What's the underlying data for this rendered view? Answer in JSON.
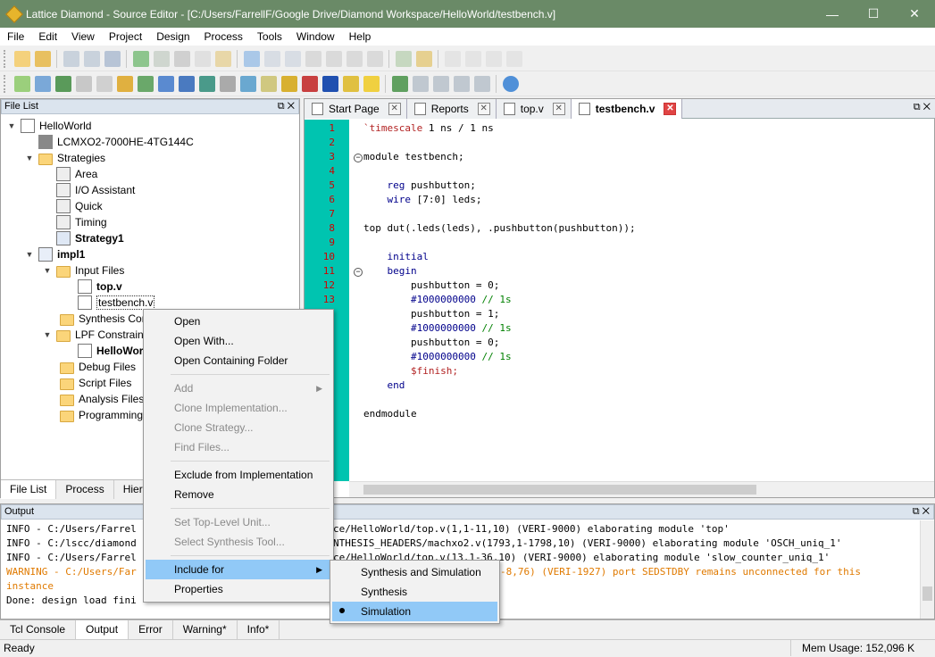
{
  "window": {
    "title": "Lattice Diamond - Source Editor - [C:/Users/FarrellF/Google Drive/Diamond Workspace/HelloWorld/testbench.v]",
    "minimize": "—",
    "maximize": "☐",
    "close": "✕"
  },
  "menubar": [
    "File",
    "Edit",
    "View",
    "Project",
    "Design",
    "Process",
    "Tools",
    "Window",
    "Help"
  ],
  "file_list": {
    "title": "File List",
    "tree": {
      "project": "HelloWorld",
      "device": "LCMXO2-7000HE-4TG144C",
      "strategies": "Strategies",
      "strategy_items": [
        "Area",
        "I/O Assistant",
        "Quick",
        "Timing",
        "Strategy1"
      ],
      "impl": "impl1",
      "input_files": "Input Files",
      "top_file": "top.v",
      "testbench_file": "testbench.v",
      "synthesis_constraint": "Synthesis Cor",
      "lpf_constraint": "LPF Constrain",
      "lpf_file": "HelloWor",
      "debug_files": "Debug Files",
      "script_files": "Script Files",
      "analysis_files": "Analysis Files",
      "programming": "Programming"
    },
    "tabs": [
      "File List",
      "Process",
      "Hiera"
    ]
  },
  "editor": {
    "tabs": [
      {
        "label": "Start Page"
      },
      {
        "label": "Reports"
      },
      {
        "label": "top.v"
      },
      {
        "label": "testbench.v"
      }
    ],
    "line_numbers": [
      "1",
      "2",
      "3",
      "4",
      "5",
      "6",
      "7",
      "8",
      "9",
      "10",
      "11",
      "12",
      "13"
    ],
    "code": {
      "l1_dir": "`timescale",
      "l1_rest": " 1 ns / 1 ns",
      "l3": "module testbench;",
      "l5a": "    reg",
      "l5b": " pushbutton;",
      "l6a": "    wire",
      "l6b": " [7:0] leds;",
      "l8": "top dut(.leds(leds), .pushbutton(pushbutton));",
      "l10": "    initial",
      "l11": "    begin",
      "l12": "        pushbutton = 0;",
      "l13a": "        #1000000000",
      "l13b": " // 1s",
      "l14": "        pushbutton = 1;",
      "l15a": "        #1000000000",
      "l15b": " // 1s",
      "l16": "        pushbutton = 0;",
      "l17a": "        #1000000000",
      "l17b": " // 1s",
      "l18": "        $finish;",
      "l19": "    end",
      "l21": "endmodule"
    }
  },
  "output": {
    "title": "Output",
    "lines": [
      {
        "left": "INFO - C:/Users/Farrel",
        "right": "ce/HelloWorld/top.v(1,1-11,10) (VERI-9000) elaborating module 'top'"
      },
      {
        "left": "INFO - C:/lscc/diamond",
        "right": "NTHESIS_HEADERS/machxo2.v(1793,1-1798,10) (VERI-9000) elaborating module 'OSCH_uniq_1'"
      },
      {
        "left": "INFO - C:/Users/Farrel",
        "right": "ce/HelloWorld/top.v(13,1-36,10) (VERI-9000) elaborating module 'slow_counter_uniq_1'"
      },
      {
        "left": "WARNING - C:/Users/Far",
        "right": "-8,76) (VERI-1927) port SEDSTDBY remains unconnected for this"
      },
      {
        "left": "instance",
        "right": ""
      },
      {
        "left": "Done: design load fini",
        "right": ""
      }
    ],
    "tabs": [
      "Tcl Console",
      "Output",
      "Error",
      "Warning*",
      "Info*"
    ]
  },
  "status": {
    "left": "Ready",
    "mem": "Mem Usage: 152,096 K"
  },
  "context_menu": {
    "items": [
      "Open",
      "Open With...",
      "Open Containing Folder",
      "Add",
      "Clone Implementation...",
      "Clone Strategy...",
      "Find Files...",
      "Exclude from Implementation",
      "Remove",
      "Set Top-Level Unit...",
      "Select Synthesis Tool...",
      "Include for",
      "Properties"
    ]
  },
  "submenu": {
    "items": [
      "Synthesis and Simulation",
      "Synthesis",
      "Simulation"
    ]
  },
  "colors": {
    "titlebar": "#6a8a67",
    "gutter": "#00c4b0",
    "highlight": "#91c9f7",
    "warning": "#e07a00"
  }
}
